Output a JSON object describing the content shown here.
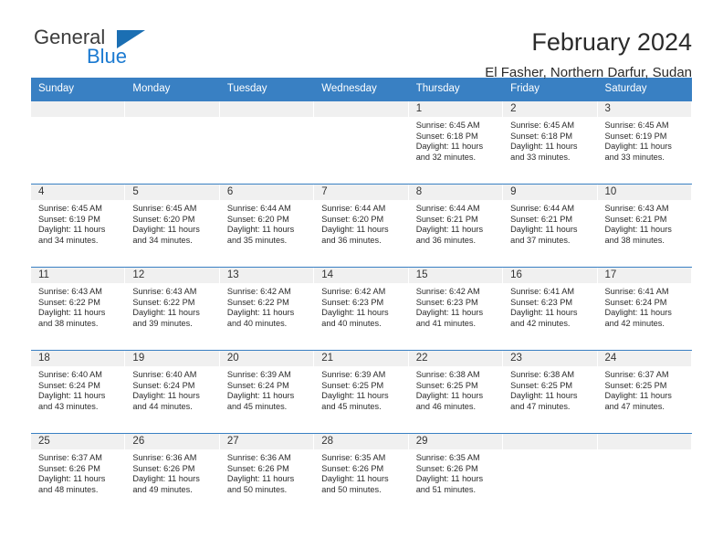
{
  "brand": {
    "name_top": "General",
    "name_bottom": "Blue",
    "accent_color": "#1b6fb3",
    "blue_text_color": "#1b7ad1"
  },
  "header": {
    "title": "February 2024",
    "subtitle": "El Fasher, Northern Darfur, Sudan"
  },
  "calendar": {
    "header_bg": "#3980c3",
    "daynum_bg": "#f0f0f0",
    "weekdays": [
      "Sunday",
      "Monday",
      "Tuesday",
      "Wednesday",
      "Thursday",
      "Friday",
      "Saturday"
    ],
    "weeks": [
      [
        {
          "day": "",
          "lines": []
        },
        {
          "day": "",
          "lines": []
        },
        {
          "day": "",
          "lines": []
        },
        {
          "day": "",
          "lines": []
        },
        {
          "day": "1",
          "lines": [
            "Sunrise: 6:45 AM",
            "Sunset: 6:18 PM",
            "Daylight: 11 hours",
            "and 32 minutes."
          ]
        },
        {
          "day": "2",
          "lines": [
            "Sunrise: 6:45 AM",
            "Sunset: 6:18 PM",
            "Daylight: 11 hours",
            "and 33 minutes."
          ]
        },
        {
          "day": "3",
          "lines": [
            "Sunrise: 6:45 AM",
            "Sunset: 6:19 PM",
            "Daylight: 11 hours",
            "and 33 minutes."
          ]
        }
      ],
      [
        {
          "day": "4",
          "lines": [
            "Sunrise: 6:45 AM",
            "Sunset: 6:19 PM",
            "Daylight: 11 hours",
            "and 34 minutes."
          ]
        },
        {
          "day": "5",
          "lines": [
            "Sunrise: 6:45 AM",
            "Sunset: 6:20 PM",
            "Daylight: 11 hours",
            "and 34 minutes."
          ]
        },
        {
          "day": "6",
          "lines": [
            "Sunrise: 6:44 AM",
            "Sunset: 6:20 PM",
            "Daylight: 11 hours",
            "and 35 minutes."
          ]
        },
        {
          "day": "7",
          "lines": [
            "Sunrise: 6:44 AM",
            "Sunset: 6:20 PM",
            "Daylight: 11 hours",
            "and 36 minutes."
          ]
        },
        {
          "day": "8",
          "lines": [
            "Sunrise: 6:44 AM",
            "Sunset: 6:21 PM",
            "Daylight: 11 hours",
            "and 36 minutes."
          ]
        },
        {
          "day": "9",
          "lines": [
            "Sunrise: 6:44 AM",
            "Sunset: 6:21 PM",
            "Daylight: 11 hours",
            "and 37 minutes."
          ]
        },
        {
          "day": "10",
          "lines": [
            "Sunrise: 6:43 AM",
            "Sunset: 6:21 PM",
            "Daylight: 11 hours",
            "and 38 minutes."
          ]
        }
      ],
      [
        {
          "day": "11",
          "lines": [
            "Sunrise: 6:43 AM",
            "Sunset: 6:22 PM",
            "Daylight: 11 hours",
            "and 38 minutes."
          ]
        },
        {
          "day": "12",
          "lines": [
            "Sunrise: 6:43 AM",
            "Sunset: 6:22 PM",
            "Daylight: 11 hours",
            "and 39 minutes."
          ]
        },
        {
          "day": "13",
          "lines": [
            "Sunrise: 6:42 AM",
            "Sunset: 6:22 PM",
            "Daylight: 11 hours",
            "and 40 minutes."
          ]
        },
        {
          "day": "14",
          "lines": [
            "Sunrise: 6:42 AM",
            "Sunset: 6:23 PM",
            "Daylight: 11 hours",
            "and 40 minutes."
          ]
        },
        {
          "day": "15",
          "lines": [
            "Sunrise: 6:42 AM",
            "Sunset: 6:23 PM",
            "Daylight: 11 hours",
            "and 41 minutes."
          ]
        },
        {
          "day": "16",
          "lines": [
            "Sunrise: 6:41 AM",
            "Sunset: 6:23 PM",
            "Daylight: 11 hours",
            "and 42 minutes."
          ]
        },
        {
          "day": "17",
          "lines": [
            "Sunrise: 6:41 AM",
            "Sunset: 6:24 PM",
            "Daylight: 11 hours",
            "and 42 minutes."
          ]
        }
      ],
      [
        {
          "day": "18",
          "lines": [
            "Sunrise: 6:40 AM",
            "Sunset: 6:24 PM",
            "Daylight: 11 hours",
            "and 43 minutes."
          ]
        },
        {
          "day": "19",
          "lines": [
            "Sunrise: 6:40 AM",
            "Sunset: 6:24 PM",
            "Daylight: 11 hours",
            "and 44 minutes."
          ]
        },
        {
          "day": "20",
          "lines": [
            "Sunrise: 6:39 AM",
            "Sunset: 6:24 PM",
            "Daylight: 11 hours",
            "and 45 minutes."
          ]
        },
        {
          "day": "21",
          "lines": [
            "Sunrise: 6:39 AM",
            "Sunset: 6:25 PM",
            "Daylight: 11 hours",
            "and 45 minutes."
          ]
        },
        {
          "day": "22",
          "lines": [
            "Sunrise: 6:38 AM",
            "Sunset: 6:25 PM",
            "Daylight: 11 hours",
            "and 46 minutes."
          ]
        },
        {
          "day": "23",
          "lines": [
            "Sunrise: 6:38 AM",
            "Sunset: 6:25 PM",
            "Daylight: 11 hours",
            "and 47 minutes."
          ]
        },
        {
          "day": "24",
          "lines": [
            "Sunrise: 6:37 AM",
            "Sunset: 6:25 PM",
            "Daylight: 11 hours",
            "and 47 minutes."
          ]
        }
      ],
      [
        {
          "day": "25",
          "lines": [
            "Sunrise: 6:37 AM",
            "Sunset: 6:26 PM",
            "Daylight: 11 hours",
            "and 48 minutes."
          ]
        },
        {
          "day": "26",
          "lines": [
            "Sunrise: 6:36 AM",
            "Sunset: 6:26 PM",
            "Daylight: 11 hours",
            "and 49 minutes."
          ]
        },
        {
          "day": "27",
          "lines": [
            "Sunrise: 6:36 AM",
            "Sunset: 6:26 PM",
            "Daylight: 11 hours",
            "and 50 minutes."
          ]
        },
        {
          "day": "28",
          "lines": [
            "Sunrise: 6:35 AM",
            "Sunset: 6:26 PM",
            "Daylight: 11 hours",
            "and 50 minutes."
          ]
        },
        {
          "day": "29",
          "lines": [
            "Sunrise: 6:35 AM",
            "Sunset: 6:26 PM",
            "Daylight: 11 hours",
            "and 51 minutes."
          ]
        },
        {
          "day": "",
          "lines": []
        },
        {
          "day": "",
          "lines": []
        }
      ]
    ]
  }
}
